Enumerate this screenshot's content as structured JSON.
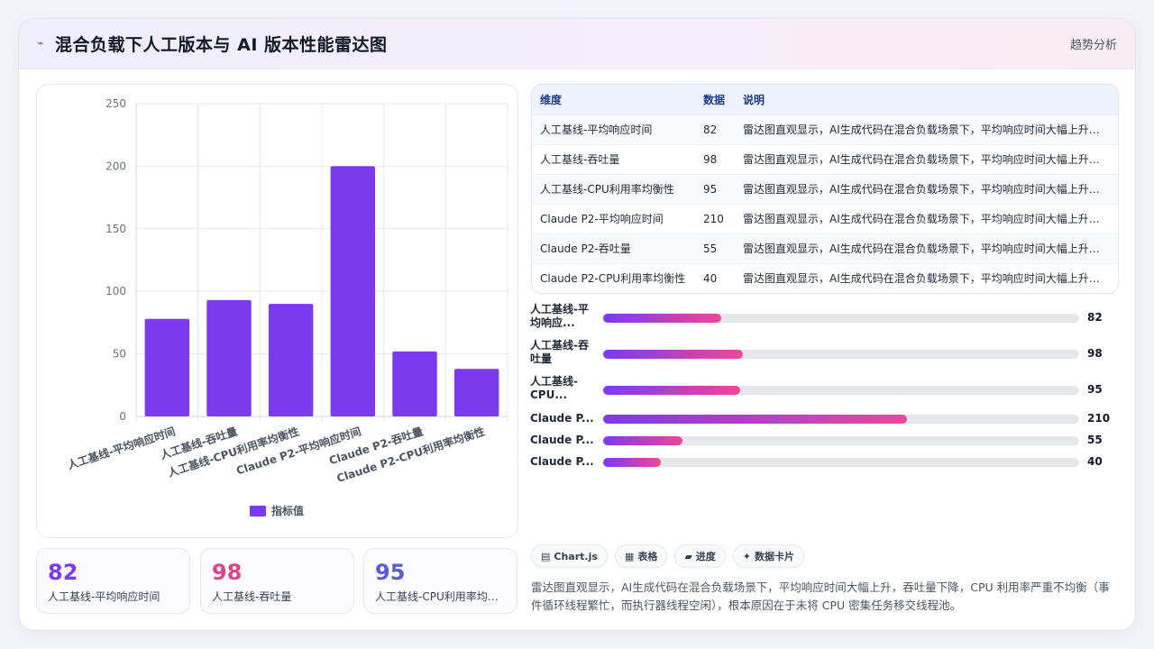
{
  "header": {
    "icon": "pulse-icon",
    "title": "混合负载下人工版本与 AI 版本性能雷达图",
    "action_label": "趋势分析"
  },
  "chart_data": {
    "type": "bar",
    "categories": [
      "人工基线-平均响应时间",
      "人工基线-吞吐量",
      "人工基线-CPU利用率均衡性",
      "Claude P2-平均响应时间",
      "Claude P2-吞吐量",
      "Claude P2-CPU利用率均衡性"
    ],
    "series": [
      {
        "name": "指标值",
        "values": [
          78,
          93,
          90,
          200,
          52,
          38
        ],
        "color": "#7c3aed"
      }
    ],
    "yticks": [
      "0",
      "50",
      "100",
      "150",
      "200",
      "250"
    ],
    "ylim": [
      0,
      250
    ],
    "grid": true,
    "legend": "bottom"
  },
  "kpis": [
    {
      "value": "82",
      "label": "人工基线-平均响应时间",
      "color": "#7c3aed"
    },
    {
      "value": "98",
      "label": "人工基线-吞吐量",
      "color": "#e0428d"
    },
    {
      "value": "95",
      "label": "人工基线-CPU利用率均衡性",
      "color": "#5b5bd6"
    }
  ],
  "table": {
    "headers": [
      "维度",
      "数据",
      "说明"
    ],
    "rows": [
      [
        "人工基线-平均响应时间",
        "82",
        "雷达图直观显示，AI生成代码在混合负载场景下，平均响应时间大幅上升，吞吐量下降"
      ],
      [
        "人工基线-吞吐量",
        "98",
        "雷达图直观显示，AI生成代码在混合负载场景下，平均响应时间大幅上升，吞吐量下降"
      ],
      [
        "人工基线-CPU利用率均衡性",
        "95",
        "雷达图直观显示，AI生成代码在混合负载场景下，平均响应时间大幅上升，吞吐量下降"
      ],
      [
        "Claude P2-平均响应时间",
        "210",
        "雷达图直观显示，AI生成代码在混合负载场景下，平均响应时间大幅上升，吞吐量下降"
      ],
      [
        "Claude P2-吞吐量",
        "55",
        "雷达图直观显示，AI生成代码在混合负载场景下，平均响应时间大幅上升，吞吐量下降"
      ],
      [
        "Claude P2-CPU利用率均衡性",
        "40",
        "雷达图直观显示，AI生成代码在混合负载场景下，平均响应时间大幅上升，吞吐量下降"
      ]
    ]
  },
  "progress": [
    {
      "label": "人工基线-平均响应...",
      "value": "82",
      "fraction": 0.248
    },
    {
      "label": "人工基线-吞吐量",
      "value": "98",
      "fraction": 0.293
    },
    {
      "label": "人工基线-CPU...",
      "value": "95",
      "fraction": 0.288
    },
    {
      "label": "Claude P...",
      "value": "210",
      "fraction": 0.639
    },
    {
      "label": "Claude P...",
      "value": "55",
      "fraction": 0.166
    },
    {
      "label": "Claude P...",
      "value": "40",
      "fraction": 0.121
    }
  ],
  "tags": [
    {
      "icon": "chart-icon",
      "glyph": "▤",
      "label": "Chart.js"
    },
    {
      "icon": "table-icon",
      "glyph": "▦",
      "label": "表格"
    },
    {
      "icon": "progress-icon",
      "glyph": "▰",
      "label": "进度"
    },
    {
      "icon": "sparkle-icon",
      "glyph": "✦",
      "label": "数据卡片"
    }
  ],
  "summary": "雷达图直观显示，AI生成代码在混合负载场景下，平均响应时间大幅上升，吞吐量下降，CPU 利用率严重不均衡（事件循环线程繁忙，而执行器线程空闲），根本原因在于未将 CPU 密集任务移交线程池。"
}
